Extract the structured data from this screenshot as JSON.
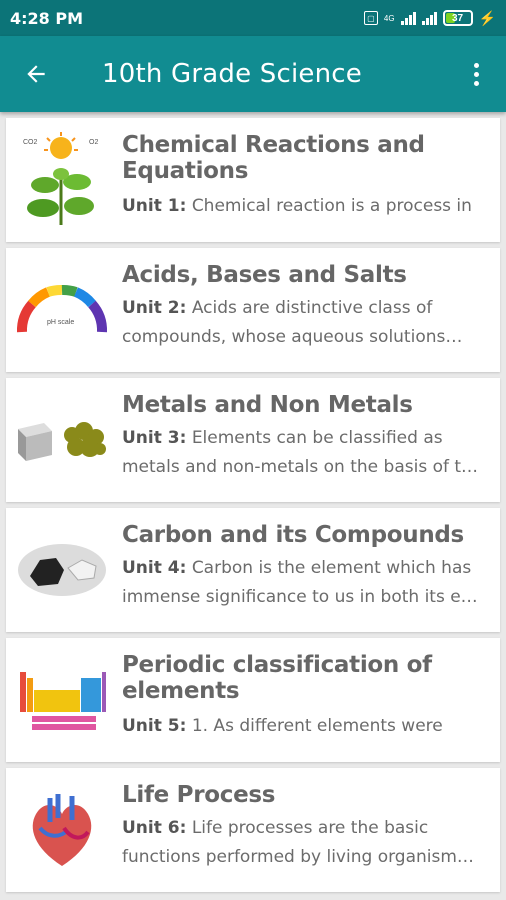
{
  "status": {
    "time": "4:28 PM",
    "sim": "4G",
    "battery": "37",
    "battery_level": 0.37
  },
  "header": {
    "title": "10th Grade Science",
    "back_icon": "arrow-back-icon",
    "menu_icon": "more-vert-icon"
  },
  "units": [
    {
      "title": "Chemical Reactions and Equations",
      "unit": "Unit 1:",
      "description": "Chemical reaction is a process in",
      "icon": "plant-photosynthesis-icon"
    },
    {
      "title": "Acids, Bases and Salts",
      "unit": "Unit 2:",
      "description": "Acids are distinctive class of compounds, whose aqueous solutions…",
      "icon": "ph-scale-icon"
    },
    {
      "title": "Metals and Non Metals",
      "unit": "Unit 3:",
      "description": "Elements can be classified as metals and non-metals on the basis of t…",
      "icon": "metal-cube-icon"
    },
    {
      "title": "Carbon and its Compounds",
      "unit": "Unit 4:",
      "description": "Carbon is the element which has immense significance to us in both its e…",
      "icon": "carbon-rocks-icon"
    },
    {
      "title": "Periodic classification of elements",
      "unit": "Unit 5:",
      "description": "1. As different elements were",
      "icon": "periodic-table-icon"
    },
    {
      "title": "Life Process",
      "unit": "Unit 6:",
      "description": "Life processes are the basic functions performed by living organism…",
      "icon": "heart-icon"
    }
  ]
}
